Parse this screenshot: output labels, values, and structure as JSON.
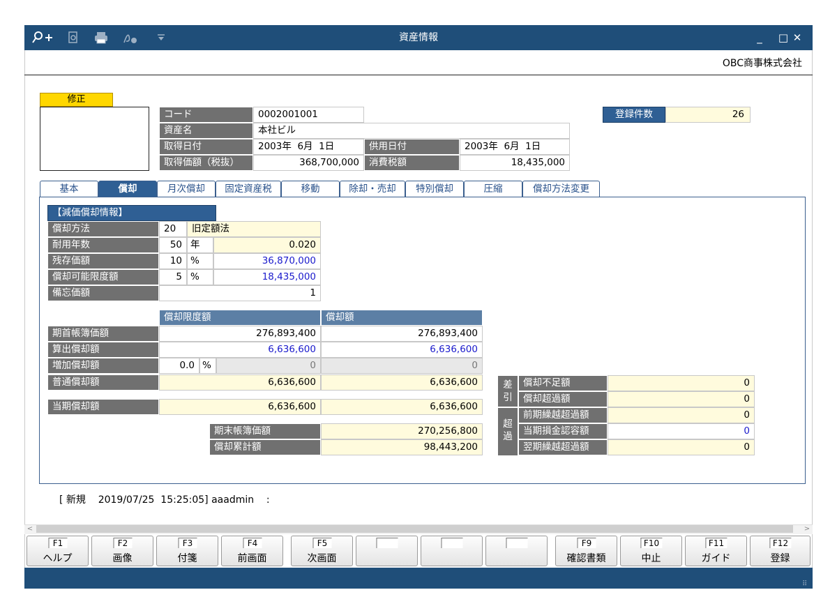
{
  "window": {
    "title": "資産情報",
    "company": "OBC商事株式会社"
  },
  "toolbar": {
    "icons": [
      "zoom-in-icon",
      "preview-icon",
      "print-icon",
      "pdf-sign-icon",
      "dropdown-icon"
    ]
  },
  "window_controls": {
    "minimize": "_",
    "maximize": "□",
    "close": "✕"
  },
  "mode_badge": "修正",
  "asset": {
    "code_label": "コード",
    "code": "0002001001",
    "name_label": "資産名",
    "name": "本社ビル",
    "acq_date_label": "取得日付",
    "acq_date": "2003年  6月  1日",
    "use_date_label": "供用日付",
    "use_date": "2003年  6月  1日",
    "acq_price_label": "取得価額（税抜）",
    "acq_price": "368,700,000",
    "tax_label": "消費税額",
    "tax": "18,435,000"
  },
  "registered": {
    "label": "登録件数",
    "value": "26"
  },
  "tabs": [
    "基本",
    "償却",
    "月次償却",
    "固定資産税",
    "移動",
    "除却・売却",
    "特別償却",
    "圧縮",
    "償却方法変更"
  ],
  "active_tab": "償却",
  "depr_info": {
    "header": "【減価償却情報】",
    "method_label": "償却方法",
    "method_code": "20",
    "method_name": "旧定額法",
    "life_label": "耐用年数",
    "life": "50",
    "life_unit": "年",
    "rate": "0.020",
    "residual_label": "残存価額",
    "residual_pct": "10",
    "residual_unit": "%",
    "residual": "36,870,000",
    "limit_label": "償却可能限度額",
    "limit_pct": "5",
    "limit_unit": "%",
    "limit": "18,435,000",
    "memo_label": "備忘価額",
    "memo": "1"
  },
  "calc": {
    "col1": "償却限度額",
    "col2": "償却額",
    "rows": [
      {
        "label": "期首帳簿価額",
        "v1": "276,893,400",
        "v2": "276,893,400"
      },
      {
        "label": "算出償却額",
        "v1": "6,636,600",
        "v2": "6,636,600"
      },
      {
        "label": "増加償却額",
        "rate": "0.0",
        "unit": "%",
        "v1": "0",
        "v2": "0"
      },
      {
        "label": "普通償却額",
        "v1": "6,636,600",
        "v2": "6,636,600"
      }
    ],
    "current_label": "当期償却額",
    "current_v1": "6,636,600",
    "current_v2": "6,636,600",
    "end_book_label": "期末帳簿価額",
    "end_book": "270,256,800",
    "accum_label": "償却累計額",
    "accum": "98,443,200"
  },
  "diff": {
    "group1_label": "差引",
    "shortage_label": "償却不足額",
    "shortage": "0",
    "excess_label": "償却超過額",
    "excess": "0",
    "group2_label": "超過",
    "prev_excess_label": "前期繰越超過額",
    "prev_excess": "0",
    "current_allow_label": "当期損金認容額",
    "current_allow": "0",
    "next_excess_label": "翌期繰越超過額",
    "next_excess": "0"
  },
  "status": "[ 新規    2019/07/25  15:25:05] aaadmin    :",
  "fkeys": [
    {
      "key": "F1",
      "label": "ヘルプ"
    },
    {
      "key": "F2",
      "label": "画像"
    },
    {
      "key": "F3",
      "label": "付箋"
    },
    {
      "key": "F4",
      "label": "前画面"
    },
    {
      "key": "F5",
      "label": "次画面"
    },
    {
      "key": "",
      "label": ""
    },
    {
      "key": "",
      "label": ""
    },
    {
      "key": "",
      "label": ""
    },
    {
      "key": "F9",
      "label": "確認書類"
    },
    {
      "key": "F10",
      "label": "中止"
    },
    {
      "key": "F11",
      "label": "ガイド"
    },
    {
      "key": "F12",
      "label": "登録"
    }
  ]
}
